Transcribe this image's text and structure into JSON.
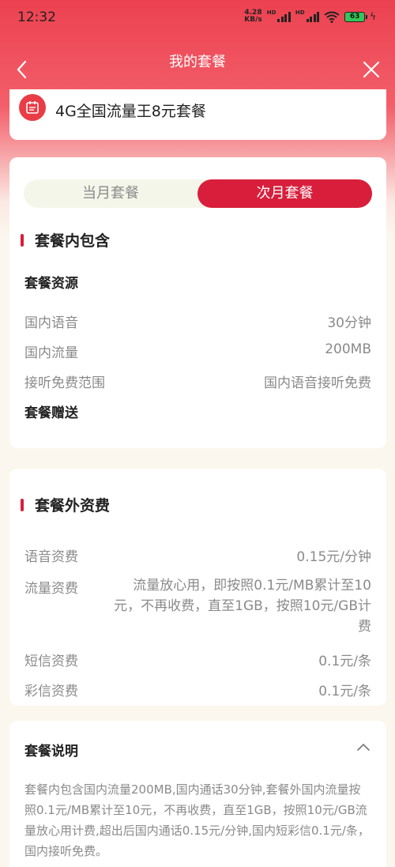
{
  "status_bar": {
    "time": "12:32",
    "net_speed_value": "4.28",
    "net_speed_unit": "KB/s",
    "hd1": "HD",
    "hd2": "HD",
    "battery": "63"
  },
  "nav": {
    "title": "我的套餐",
    "back_icon": "chevron-left-icon",
    "close_icon": "close-icon"
  },
  "plan": {
    "name": "4G全国流量王8元套餐",
    "icon": "calendar-icon"
  },
  "tabs": {
    "current_month": "当月套餐",
    "next_month": "次月套餐",
    "selected": "次月套餐"
  },
  "included": {
    "section_title": "套餐内包含",
    "resources_title": "套餐资源",
    "rows": [
      {
        "label": "国内语音",
        "value": "30分钟"
      },
      {
        "label": "国内流量",
        "value": "200MB"
      },
      {
        "label": "接听免费范围",
        "value": "国内语音接听免费"
      }
    ],
    "gift_title": "套餐赠送"
  },
  "extra": {
    "section_title": "套餐外资费",
    "rows": [
      {
        "label": "语音资费",
        "value": "0.15元/分钟"
      },
      {
        "label": "流量资费",
        "value": "流量放心用，即按照0.1元/MB累计至10元，不再收费，直至1GB，按照10元/GB计费"
      },
      {
        "label": "短信资费",
        "value": "0.1元/条"
      },
      {
        "label": "彩信资费",
        "value": "0.1元/条"
      }
    ]
  },
  "description": {
    "title": "套餐说明",
    "toggle_icon": "chevron-up-icon",
    "text": "套餐内包含国内流量200MB,国内通话30分钟,套餐外国内流量按照0.1元/MB累计至10元，不再收费，直至1GB，按照10元/GB流量放心用计费,超出后国内通话0.15元/分钟,国内短彩信0.1元/条，国内接听免费。"
  },
  "colors": {
    "brand_red": "#d81e3b",
    "header_gradient_top": "#ec4150"
  }
}
